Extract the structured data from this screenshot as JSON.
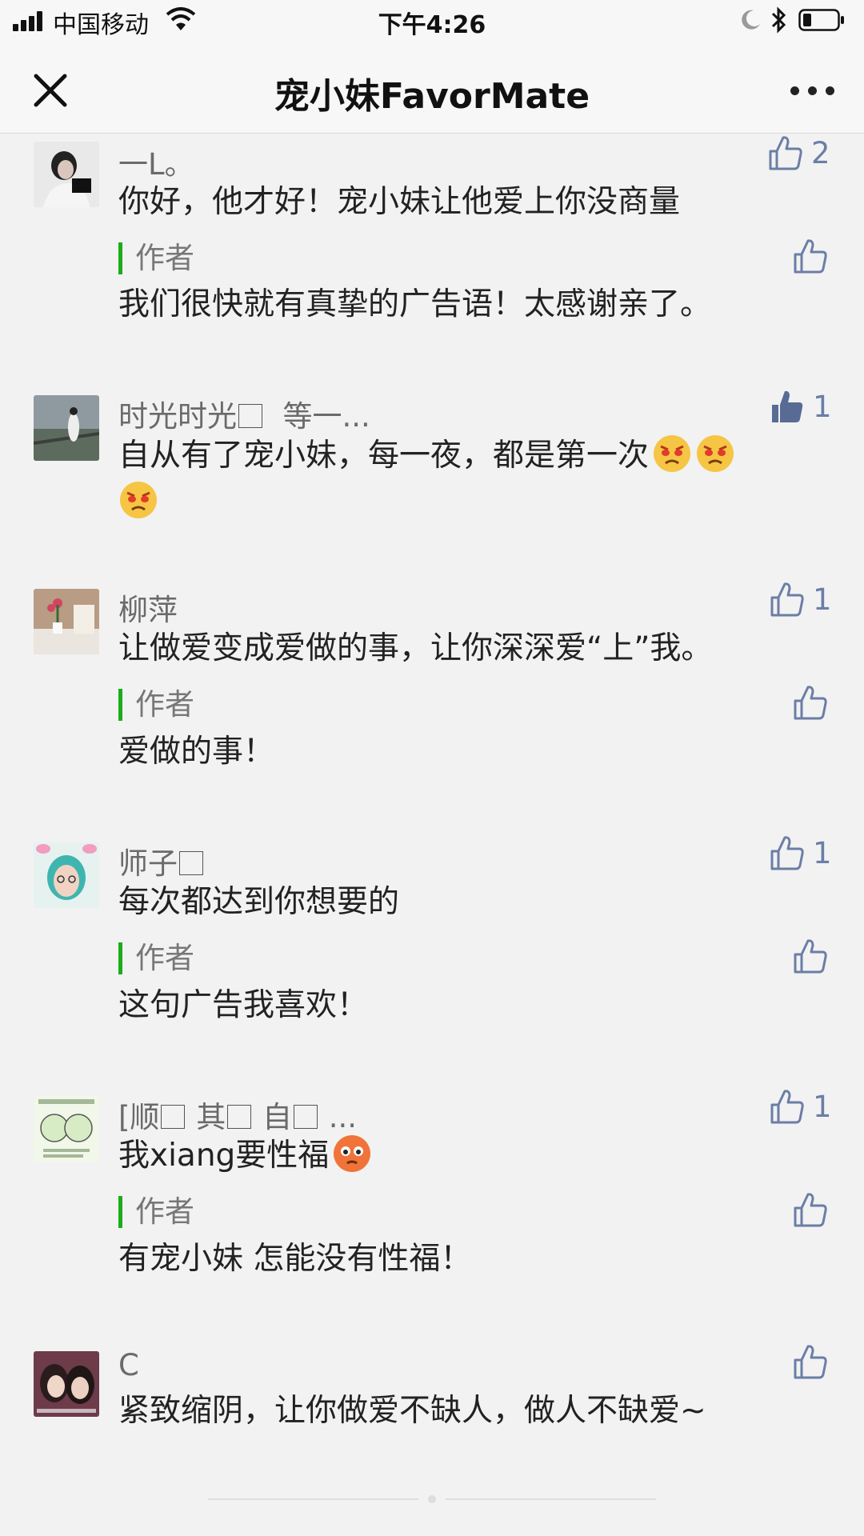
{
  "status_bar": {
    "carrier": "中国移动",
    "time": "下午4:26",
    "icons": [
      "signal-icon",
      "wifi-icon",
      "moon-icon",
      "bluetooth-icon",
      "battery-icon"
    ]
  },
  "nav": {
    "title": "宠小妹FavorMate",
    "close_icon": "close-icon",
    "more_icon": "more-icon"
  },
  "comments": [
    {
      "nickname": "一L。",
      "text": "你好，他才好！宠小妹让他爱上你没商量",
      "likes": "2",
      "liked": false,
      "author_label": "作者",
      "reply": "我们很快就有真挚的广告语！太感谢亲了。"
    },
    {
      "nickname": "时光时光",
      "nickname_suffix": "等一...",
      "text": "自从有了宠小妹，每一夜，都是第一次",
      "likes": "1",
      "liked": true
    },
    {
      "nickname": "柳萍",
      "text": "让做爱变成爱做的事，让你深深爱“上”我。",
      "likes": "1",
      "liked": false,
      "author_label": "作者",
      "reply": "爱做的事！"
    },
    {
      "nickname": "师子",
      "text": "每次都达到你想要的",
      "likes": "1",
      "liked": false,
      "author_label": "作者",
      "reply": "这句广告我喜欢！"
    },
    {
      "nickname_parts": [
        "[顺",
        "其",
        "自",
        "..."
      ],
      "text": "我xiang要性福",
      "likes": "1",
      "liked": false,
      "author_label": "作者",
      "reply": "有宠小妹 怎能没有性福！"
    },
    {
      "nickname": "C",
      "text": "紧致缩阴，让你做爱不缺人，做人不缺爱~",
      "likes": "",
      "liked": false
    }
  ],
  "colors": {
    "accent_green": "#1aad19",
    "like_blue": "#6b7ea6",
    "liked_fill": "#576b95",
    "background": "#f2f2f2"
  }
}
